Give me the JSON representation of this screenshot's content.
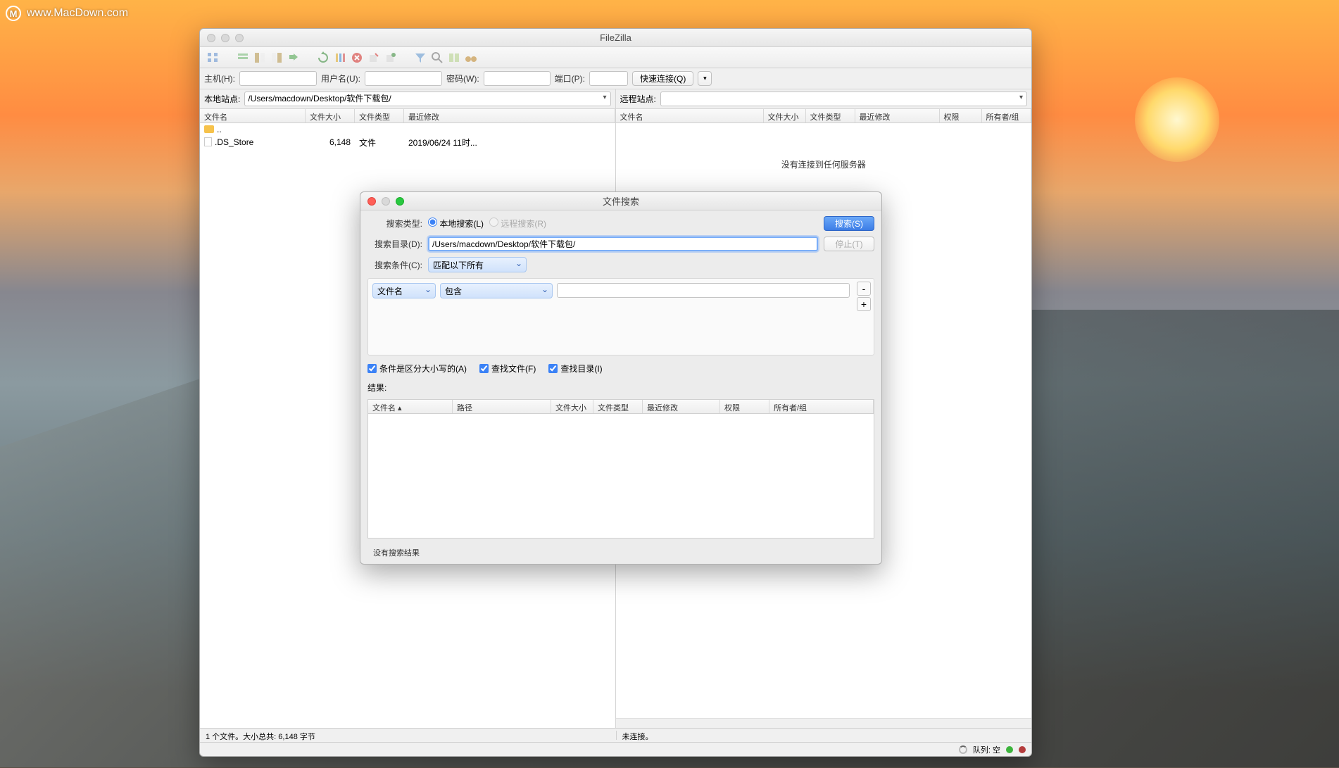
{
  "watermark": {
    "url": "www.MacDown.com"
  },
  "main": {
    "title": "FileZilla",
    "conn": {
      "host_label": "主机(H):",
      "user_label": "用户名(U):",
      "pass_label": "密码(W):",
      "port_label": "端口(P):",
      "quickconnect": "快速连接(Q)"
    },
    "local": {
      "label": "本地站点:",
      "path": "/Users/macdown/Desktop/软件下载包/",
      "cols": [
        "文件名",
        "文件大小",
        "文件类型",
        "最近修改"
      ],
      "rows": [
        {
          "name": "..",
          "size": "",
          "type": "",
          "mod": "",
          "icon": "folder"
        },
        {
          "name": ".DS_Store",
          "size": "6,148",
          "type": "文件",
          "mod": "2019/06/24 11时...",
          "icon": "file"
        }
      ]
    },
    "remote": {
      "label": "远程站点:",
      "cols": [
        "文件名",
        "文件大小",
        "文件类型",
        "最近修改",
        "权限",
        "所有者/组"
      ],
      "empty_msg": "没有连接到任何服务器"
    },
    "status_left": "1 个文件。大小总共: 6,148 字节",
    "status_right": "未连接。",
    "footer_queue": "队列: 空"
  },
  "search": {
    "title": "文件搜索",
    "type_label": "搜索类型:",
    "type_local": "本地搜索(L)",
    "type_remote": "远程搜索(R)",
    "dir_label": "搜索目录(D):",
    "dir_value": "/Users/macdown/Desktop/软件下载包/",
    "cond_label": "搜索条件(C):",
    "cond_match": "匹配以下所有",
    "cond_field": "文件名",
    "cond_op": "包含",
    "chk_case": "条件是区分大小写的(A)",
    "chk_files": "查找文件(F)",
    "chk_dirs": "查找目录(I)",
    "results_label": "结果:",
    "results_cols": [
      "文件名 ▴",
      "路径",
      "文件大小",
      "文件类型",
      "最近修改",
      "权限",
      "所有者/组"
    ],
    "btn_search": "搜索(S)",
    "btn_stop": "停止(T)",
    "no_results": "没有搜索结果"
  }
}
